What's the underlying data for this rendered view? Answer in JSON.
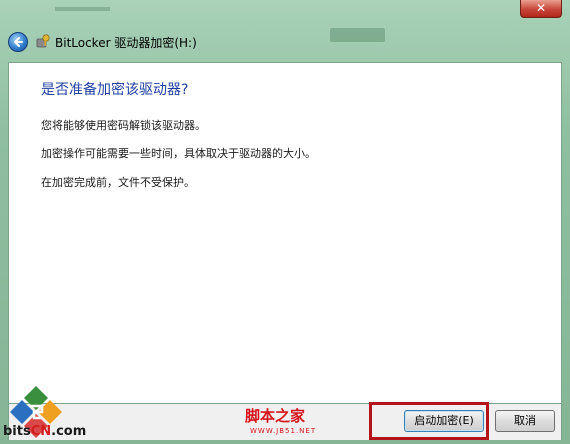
{
  "window": {
    "title": "BitLocker 驱动器加密(H:)",
    "close_label": "✕"
  },
  "content": {
    "heading": "是否准备加密该驱动器?",
    "paragraphs": [
      "您将能够使用密码解锁该驱动器。",
      "加密操作可能需要一些时间，具体取决于驱动器的大小。",
      "在加密完成前，文件不受保护。"
    ]
  },
  "footer": {
    "start_button": "启动加密(E)",
    "cancel_button": "取消"
  },
  "watermarks": {
    "left_logo_prefix": "bits",
    "left_logo_cn": "CN",
    "left_logo_suffix": ".com",
    "center_main": "脚本之家",
    "center_url": "WWW.JB51.NET"
  },
  "colors": {
    "heading": "#1f3fa0",
    "highlight_box": "#b3141a",
    "watermark": "#d6141b"
  },
  "icons": [
    "back-arrow-icon",
    "bitlocker-key-icon",
    "close-icon"
  ]
}
